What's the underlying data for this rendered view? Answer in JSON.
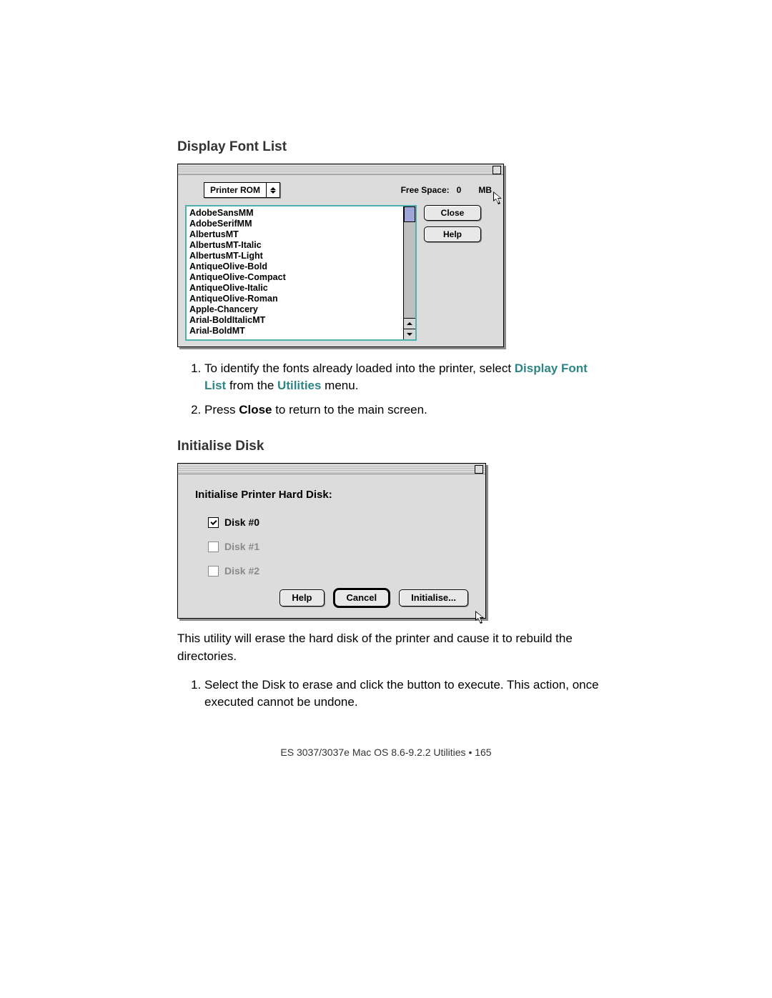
{
  "section1": {
    "heading": "Display Font List",
    "dropdown_label": "Printer ROM",
    "free_space_label": "Free Space:",
    "free_space_value": "0",
    "free_space_unit": "MB",
    "close_btn": "Close",
    "help_btn": "Help",
    "fonts": [
      "AdobeSansMM",
      "AdobeSerifMM",
      "AlbertusMT",
      "AlbertusMT-Italic",
      "AlbertusMT-Light",
      "AntiqueOlive-Bold",
      "AntiqueOlive-Compact",
      "AntiqueOlive-Italic",
      "AntiqueOlive-Roman",
      "Apple-Chancery",
      "Arial-BoldItalicMT",
      "Arial-BoldMT"
    ],
    "step1_pre": "To identify the fonts already loaded into the printer, select ",
    "step1_em1": "Display Font List",
    "step1_mid": " from the ",
    "step1_em2": "Utilities",
    "step1_end": " menu.",
    "step2_pre": "Press ",
    "step2_em": "Close",
    "step2_end": " to return to the main screen."
  },
  "section2": {
    "heading": "Initialise Disk",
    "prompt": "Initialise Printer Hard Disk:",
    "disks": [
      {
        "label": "Disk #0",
        "checked": true,
        "enabled": true
      },
      {
        "label": "Disk #1",
        "checked": false,
        "enabled": false
      },
      {
        "label": "Disk #2",
        "checked": false,
        "enabled": false
      }
    ],
    "help_btn": "Help",
    "cancel_btn": "Cancel",
    "init_btn": "Initialise...",
    "desc": "This utility will erase the hard disk of the printer and cause it to rebuild the directories.",
    "step1": "Select the Disk to erase and click the button to execute.  This action, once executed cannot be undone."
  },
  "footer": "ES 3037/3037e Mac OS 8.6-9.2.2 Utilities • 165"
}
